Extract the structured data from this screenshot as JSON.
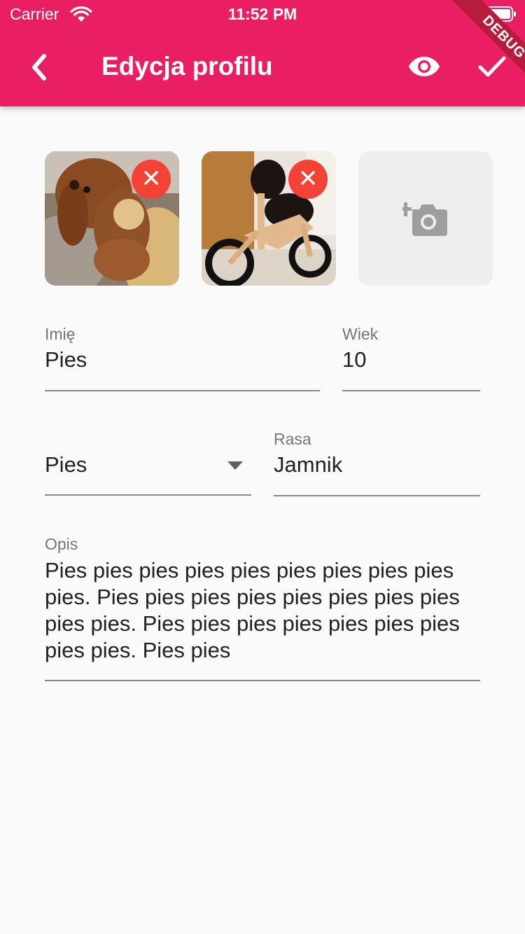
{
  "status_bar": {
    "carrier": "Carrier",
    "time": "11:52 PM"
  },
  "app_bar": {
    "title": "Edycja profilu",
    "debug_label": "DEBUG",
    "color": "#e91e63",
    "back_icon": "chevron-left-icon",
    "preview_icon": "eye-icon",
    "save_icon": "check-icon"
  },
  "photos": {
    "items": [
      {
        "description": "dog-with-teddy-bear",
        "remove_icon": "close-icon"
      },
      {
        "description": "dachshund-on-balance-bike",
        "remove_icon": "close-icon"
      }
    ],
    "add_icon": "add-photo-icon",
    "remove_color": "#f44336"
  },
  "form": {
    "name": {
      "label": "Imię",
      "value": "Pies"
    },
    "age": {
      "label": "Wiek",
      "value": "10"
    },
    "species": {
      "value": "Pies"
    },
    "breed": {
      "label": "Rasa",
      "value": "Jamnik"
    },
    "description": {
      "label": "Opis",
      "value": "Pies pies pies pies pies pies pies pies pies pies. Pies pies pies pies pies pies pies pies pies pies. Pies pies pies pies pies pies pies pies pies. Pies pies"
    }
  }
}
